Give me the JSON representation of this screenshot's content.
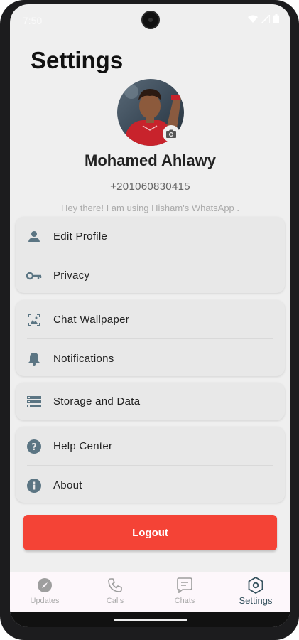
{
  "status_bar": {
    "time": "7:50"
  },
  "page_title": "Settings",
  "profile": {
    "name": "Mohamed Ahlawy",
    "phone": "+201060830415",
    "about": "Hey there! I am using Hisham's WhatsApp ."
  },
  "menu_groups": {
    "account": {
      "edit_profile": "Edit Profile",
      "privacy": "Privacy"
    },
    "appearance": {
      "chat_wallpaper": "Chat Wallpaper",
      "notifications": "Notifications"
    },
    "storage": {
      "storage_and_data": "Storage and Data"
    },
    "support": {
      "help_center": "Help Center",
      "about": "About"
    }
  },
  "logout_label": "Logout",
  "bottom_nav": {
    "updates": "Updates",
    "calls": "Calls",
    "chats": "Chats",
    "settings": "Settings",
    "active": "settings"
  },
  "colors": {
    "icon": "#5b7583",
    "logout": "#f44336",
    "nav_active": "#37535f",
    "background": "#efefef",
    "card": "#e8e8e8"
  }
}
